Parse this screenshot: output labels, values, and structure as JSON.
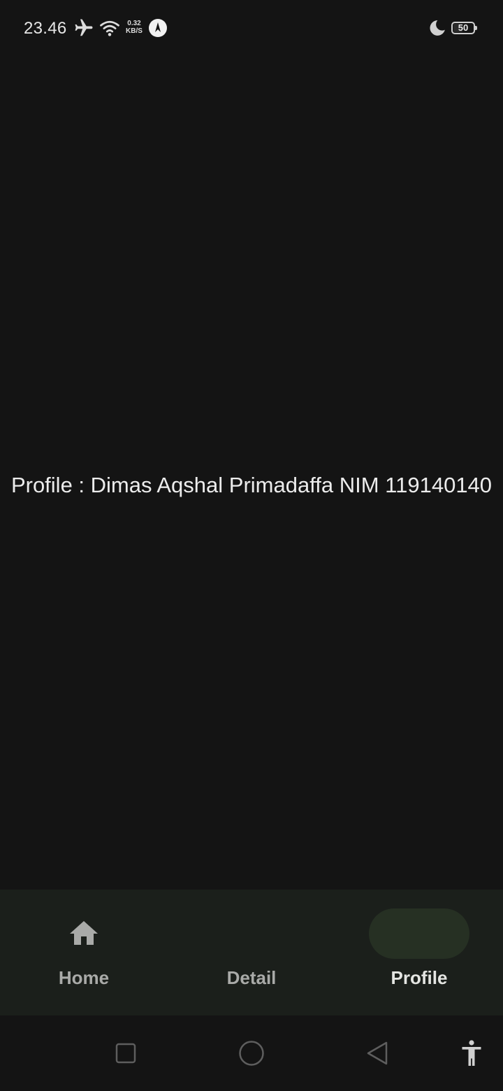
{
  "status_bar": {
    "time": "23.46",
    "net_speed_value": "0.32",
    "net_speed_unit": "KB/S",
    "battery_level": "50",
    "icons": [
      "airplane-icon",
      "wifi-icon",
      "app-notification-icon",
      "moon-icon",
      "battery-icon"
    ]
  },
  "content": {
    "profile_text": "Profile : Dimas Aqshal Primadaffa NIM 119140140"
  },
  "bottom_nav": {
    "selected": "Profile",
    "items": [
      {
        "label": "Home",
        "icon": "home-icon"
      },
      {
        "label": "Detail",
        "icon": null
      },
      {
        "label": "Profile",
        "icon": null
      }
    ]
  },
  "system_nav": {
    "buttons": [
      "recents-icon",
      "home-circle-icon",
      "back-icon",
      "accessibility-icon"
    ]
  },
  "colors": {
    "background": "#141414",
    "nav_background": "#1b1f1b",
    "nav_indicator": "#263023",
    "text": "#ececec",
    "nav_label_inactive": "#a9aaa8"
  }
}
